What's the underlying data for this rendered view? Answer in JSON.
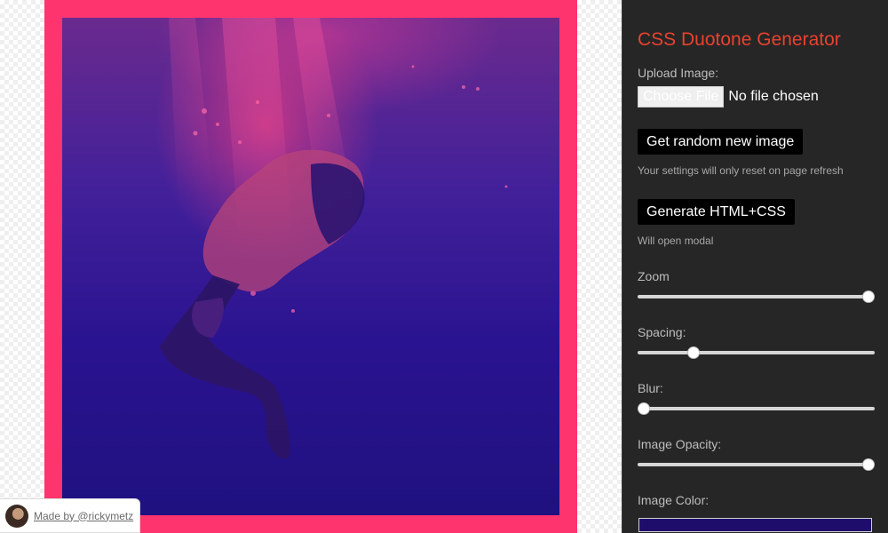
{
  "preview": {
    "frame_color": "#fe346e",
    "image_tint": "#1f0d6b"
  },
  "credit": {
    "text": "Made by @rickymetz"
  },
  "panel": {
    "title": "CSS Duotone Generator",
    "upload_label": "Upload Image:",
    "file_button": "Choose File",
    "file_status": "No file chosen",
    "random_button": "Get random new image",
    "random_hint": "Your settings will only reset on page refresh",
    "generate_button": "Generate HTML+CSS",
    "generate_hint": "Will open modal",
    "sliders": [
      {
        "label": "Zoom",
        "value": 1.0
      },
      {
        "label": "Spacing:",
        "value": 0.22
      },
      {
        "label": "Blur:",
        "value": 0.0
      },
      {
        "label": "Image Opacity:",
        "value": 1.0
      }
    ],
    "color_label": "Image Color:",
    "color_value": "#1f0d6b"
  },
  "colors": {
    "accent": "#e9422f",
    "panel_bg": "#262626"
  }
}
